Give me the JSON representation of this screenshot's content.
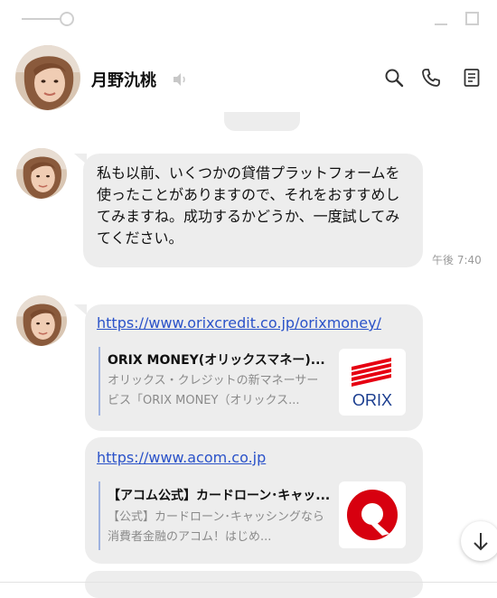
{
  "contact": {
    "name": "月野氿桃"
  },
  "messages": [
    {
      "text": "私も以前、いくつかの貸借プラットフォームを使ったことがありますので、それをおすすめしてみますね。成功するかどうか、一度試してみてください。",
      "time": "午後 7:40"
    },
    {
      "links": [
        {
          "url": "https://www.orixcredit.co.jp/orixmoney/",
          "title": "ORIX MONEY(オリックスマネー)...",
          "description": "オリックス・クレジットの新マネーサービス「ORIX MONEY（オリックス...",
          "thumb_text": "ORIX"
        },
        {
          "url": "https://www.acom.co.jp",
          "title": "【アコム公式】カードローン･キャッ...",
          "description": "【公式】カードローン･キャッシングなら消費者金融のアコム！はじめ..."
        }
      ]
    }
  ],
  "icons": {
    "mute": "speaker-muted-icon",
    "search": "search-icon",
    "call": "phone-icon",
    "memo": "memo-icon",
    "scroll_down": "arrow-down-icon"
  },
  "colors": {
    "bubble": "#ededed",
    "link": "#2a52c9",
    "orix_red": "#e60012",
    "acom_red": "#d7000f"
  }
}
